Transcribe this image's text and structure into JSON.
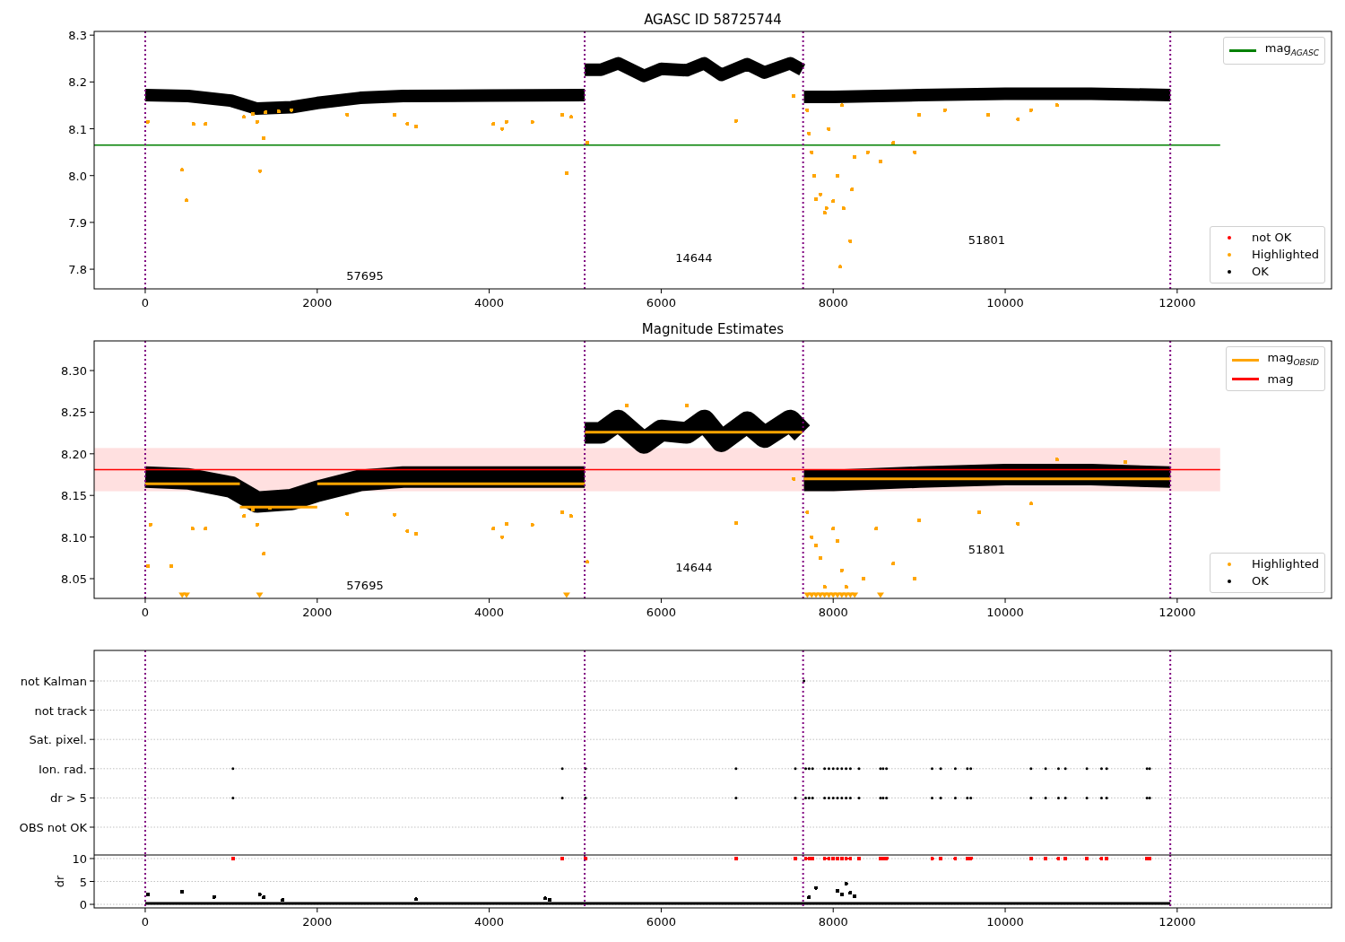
{
  "figure": {
    "panels": [
      {
        "chart_data": {
          "type": "scatter",
          "title": "AGASC ID 58725744",
          "xlim": [
            -594,
            13795
          ],
          "ylim": [
            7.758,
            8.308
          ],
          "xticks": [
            0,
            2000,
            4000,
            6000,
            8000,
            10000,
            12000
          ],
          "yticks": [
            {
              "value": 7.8,
              "label": "7.8"
            },
            {
              "value": 7.9,
              "label": "7.9"
            },
            {
              "value": 8,
              "label": "8.0"
            },
            {
              "value": 8.1,
              "label": "8.1"
            },
            {
              "value": 8.2,
              "label": "8.2"
            },
            {
              "value": 8.3,
              "label": "8.3"
            }
          ],
          "ref_lines": [
            {
              "axis": "y",
              "value": 8.065,
              "color": "#008000"
            },
            {
              "axis": "x",
              "value": 0,
              "color": "#800080"
            },
            {
              "axis": "x",
              "value": 5110,
              "color": "#800080"
            },
            {
              "axis": "x",
              "value": 7650,
              "color": "#800080"
            },
            {
              "axis": "x",
              "value": 11920,
              "color": "#800080"
            }
          ],
          "series": [
            {
              "type": "line",
              "color": "#000000",
              "x": [
                0,
                500,
                1000,
                1300,
                1700,
                2000,
                2500,
                3000,
                4000,
                5110
              ],
              "values": [
                8.172,
                8.17,
                8.16,
                8.143,
                8.146,
                8.155,
                8.166,
                8.17,
                8.171,
                8.172
              ]
            },
            {
              "type": "line",
              "color": "#000000",
              "x": [
                5110,
                5300,
                5500,
                5800,
                6000,
                6300,
                6500,
                6700,
                7000,
                7200,
                7500,
                7640
              ],
              "values": [
                8.226,
                8.226,
                8.24,
                8.213,
                8.228,
                8.225,
                8.24,
                8.215,
                8.238,
                8.22,
                8.24,
                8.226
              ]
            },
            {
              "type": "line",
              "color": "#000000",
              "x": [
                7660,
                8000,
                9000,
                10000,
                11000,
                11920
              ],
              "values": [
                8.168,
                8.168,
                8.172,
                8.175,
                8.175,
                8.172
              ]
            },
            {
              "type": "scatter",
              "color": "#ffa500",
              "x": [
                30,
                280,
                430,
                480,
                560,
                700,
                1150,
                1250,
                1300,
                1330,
                1380,
                1400,
                1550,
                1700,
                2350,
                2900,
                3050,
                3150,
                4050,
                4150,
                4200,
                4500,
                4850,
                4900,
                4950,
                5140,
                6870,
                7540,
                7700,
                7720,
                7750,
                7780,
                7800,
                7850,
                7900,
                7920,
                7950,
                8000,
                8050,
                8080,
                8100,
                8120,
                8200,
                8220,
                8250,
                8400,
                8550,
                8700,
                8950,
                9000,
                9300,
                9800,
                10150,
                10300,
                10600
              ],
              "values": [
                8.115,
                null,
                8.012,
                7.947,
                8.11,
                8.11,
                8.125,
                8.132,
                8.115,
                8.01,
                8.08,
                8.135,
                8.137,
                8.14,
                8.13,
                8.13,
                8.11,
                8.105,
                8.11,
                8.1,
                8.115,
                8.115,
                8.13,
                8.005,
                8.125,
                8.07,
                8.117,
                8.17,
                8.14,
                8.09,
                8.05,
                8.0,
                7.95,
                7.96,
                7.92,
                7.93,
                8.1,
                7.945,
                8.0,
                7.805,
                8.15,
                7.93,
                7.86,
                7.97,
                8.04,
                8.05,
                8.03,
                8.07,
                8.05,
                8.13,
                8.14,
                8.13,
                8.12,
                8.14,
                8.15
              ]
            }
          ],
          "annotations": [
            "57695",
            "14644",
            "51801"
          ]
        },
        "legends": [
          {
            "entries": [
              {
                "label": "mag$_{AGASC}$",
                "kind": "line",
                "color": "#008000"
              }
            ]
          },
          {
            "entries": [
              {
                "label": "not OK",
                "kind": "dot",
                "color": "#ff0000"
              },
              {
                "label": "Highlighted",
                "kind": "dot",
                "color": "#ffa500"
              },
              {
                "label": "OK",
                "kind": "dot",
                "color": "#000000"
              }
            ]
          }
        ]
      },
      {
        "chart_data": {
          "type": "scatter",
          "title": "Magnitude Estimates",
          "xlim": [
            -594,
            13795
          ],
          "ylim": [
            8.0263,
            8.3356
          ],
          "xticks": [
            0,
            2000,
            4000,
            6000,
            8000,
            10000,
            12000
          ],
          "yticks": [
            {
              "value": 8.05,
              "label": "8.05"
            },
            {
              "value": 8.1,
              "label": "8.10"
            },
            {
              "value": 8.15,
              "label": "8.15"
            },
            {
              "value": 8.2,
              "label": "8.20"
            },
            {
              "value": 8.25,
              "label": "8.25"
            },
            {
              "value": 8.3,
              "label": "8.30"
            }
          ],
          "bands": [
            {
              "axis": "y",
              "from": 8.155,
              "to": 8.207,
              "color": "#ff0000"
            }
          ],
          "ref_lines": [
            {
              "axis": "y",
              "value": 8.181,
              "color": "#ff0000"
            },
            {
              "axis": "x",
              "value": 0,
              "color": "#800080"
            },
            {
              "axis": "x",
              "value": 5110,
              "color": "#800080"
            },
            {
              "axis": "x",
              "value": 7650,
              "color": "#800080"
            },
            {
              "axis": "x",
              "value": 11920,
              "color": "#800080"
            }
          ],
          "series": [
            {
              "type": "line",
              "color": "#000000",
              "x": [
                0,
                500,
                1000,
                1300,
                1700,
                2000,
                2500,
                3000,
                4000,
                5110
              ],
              "values": [
                8.172,
                8.17,
                8.16,
                8.142,
                8.145,
                8.155,
                8.168,
                8.172,
                8.172,
                8.172
              ]
            },
            {
              "type": "line",
              "color": "#000000",
              "x": [
                5110,
                5300,
                5500,
                5800,
                6000,
                6300,
                6500,
                6700,
                7000,
                7200,
                7500,
                7640
              ],
              "values": [
                8.225,
                8.225,
                8.24,
                8.213,
                8.228,
                8.225,
                8.24,
                8.215,
                8.238,
                8.22,
                8.24,
                8.225
              ]
            },
            {
              "type": "line",
              "color": "#000000",
              "x": [
                7660,
                8000,
                9000,
                10000,
                11000,
                11920
              ],
              "values": [
                8.168,
                8.168,
                8.172,
                8.175,
                8.175,
                8.172
              ]
            },
            {
              "type": "line",
              "color": "#ffa500",
              "x": [
                0,
                1100
              ],
              "values": [
                8.164,
                8.164
              ]
            },
            {
              "type": "line",
              "color": "#ffa500",
              "x": [
                1100,
                2000
              ],
              "values": [
                8.136,
                8.136
              ]
            },
            {
              "type": "line",
              "color": "#ffa500",
              "x": [
                2000,
                5110
              ],
              "values": [
                8.164,
                8.164
              ]
            },
            {
              "type": "line",
              "color": "#ffa500",
              "x": [
                5110,
                7640
              ],
              "values": [
                8.226,
                8.226
              ]
            },
            {
              "type": "line",
              "color": "#ffa500",
              "x": [
                7660,
                11920
              ],
              "values": [
                8.17,
                8.17
              ]
            },
            {
              "type": "scatter",
              "color": "#ffa500",
              "x": [
                30,
                60,
                300,
                550,
                700,
                1150,
                1250,
                1300,
                1380,
                1450,
                2350,
                2900,
                3050,
                3150,
                4050,
                4150,
                4200,
                4500,
                4850,
                4950,
                5140,
                5600,
                6300,
                6870,
                7540,
                7700,
                7750,
                7800,
                7850,
                7900,
                8000,
                8050,
                8100,
                8150,
                8350,
                8500,
                8700,
                8950,
                9000,
                9700,
                10150,
                10300,
                10600,
                11400
              ],
              "values": [
                8.065,
                8.115,
                8.065,
                8.11,
                8.11,
                8.125,
                8.133,
                8.115,
                8.08,
                8.135,
                8.128,
                8.127,
                8.107,
                8.104,
                8.11,
                8.1,
                8.116,
                8.115,
                8.13,
                8.125,
                8.07,
                8.258,
                8.258,
                8.117,
                8.17,
                8.13,
                8.1,
                8.09,
                8.075,
                8.04,
                8.11,
                8.095,
                8.06,
                8.04,
                8.05,
                8.11,
                8.068,
                8.05,
                8.12,
                8.13,
                8.116,
                8.14,
                8.193,
                8.19
              ]
            },
            {
              "type": "scatter",
              "marker": "v",
              "color": "#ffa500",
              "x": [
                430,
                480,
                1330,
                4900,
                7700,
                7750,
                7800,
                7850,
                7900,
                7950,
                8000,
                8050,
                8100,
                8150,
                8200,
                8250,
                8550
              ],
              "values": [
                8.03,
                8.03,
                8.03,
                8.03,
                8.03,
                8.03,
                8.03,
                8.03,
                8.03,
                8.03,
                8.03,
                8.03,
                8.03,
                8.03,
                8.03,
                8.03,
                8.03
              ]
            }
          ],
          "annotations": [
            "57695",
            "14644",
            "51801"
          ]
        },
        "legends": [
          {
            "entries": [
              {
                "label": "mag$_{OBSID}$",
                "kind": "line",
                "color": "#ffa500"
              },
              {
                "label": "mag",
                "kind": "line",
                "color": "#ff0000"
              }
            ]
          },
          {
            "entries": [
              {
                "label": "Highlighted",
                "kind": "dot",
                "color": "#ffa500"
              },
              {
                "label": "OK",
                "kind": "dot",
                "color": "#000000"
              }
            ]
          }
        ]
      },
      {
        "flag_rows": [
          {
            "label": "not Kalman"
          },
          {
            "label": "not track"
          },
          {
            "label": "Sat. pixel."
          },
          {
            "label": "Ion. rad."
          },
          {
            "label": "dr > 5"
          },
          {
            "label": "OBS not OK"
          }
        ]
      },
      {
        "chart_data": {
          "type": "scatter",
          "ylabel": "dr",
          "xlim": [
            -594,
            13795
          ],
          "ylim": [
            -0.78,
            10.78
          ],
          "xticks": [
            0,
            2000,
            4000,
            6000,
            8000,
            10000,
            12000
          ],
          "yticks": [
            0,
            5,
            10
          ],
          "grid": true,
          "ref_lines": [
            {
              "axis": "x",
              "value": 0,
              "color": "#800080"
            },
            {
              "axis": "x",
              "value": 5110,
              "color": "#800080"
            },
            {
              "axis": "x",
              "value": 7650,
              "color": "#800080"
            },
            {
              "axis": "x",
              "value": 11920,
              "color": "#800080"
            }
          ],
          "series": [
            {
              "type": "line",
              "color": "#000000",
              "x": [
                0,
                2000,
                4000,
                6000,
                8000,
                10000,
                11920
              ],
              "values": [
                0.2,
                0.2,
                0.2,
                0.2,
                0.2,
                0.2,
                0.2
              ]
            },
            {
              "type": "scatter",
              "color": "#000000",
              "x": [
                30,
                430,
                800,
                1330,
                1380,
                1600,
                3150,
                4650,
                4700,
                7720,
                7800,
                8050,
                8100,
                8150,
                8200,
                8250
              ],
              "values": [
                2.2,
                2.7,
                1.6,
                2.1,
                1.5,
                0.9,
                1.1,
                1.3,
                1.0,
                1.5,
                3.6,
                3.0,
                2.2,
                4.5,
                2.5,
                1.8
              ]
            },
            {
              "type": "scatter",
              "color": "#ff0000",
              "x": [
                1020,
                4850,
                5120,
                6870,
                7560,
                7680,
                7720,
                7760,
                7900,
                7950,
                8000,
                8050,
                8100,
                8150,
                8200,
                8300,
                8550,
                8580,
                8620,
                9150,
                9250,
                9420,
                9560,
                9600,
                10300,
                10470,
                10620,
                10700,
                10950,
                11120,
                11180,
                11650,
                11680
              ],
              "values": [
                10,
                10,
                10,
                10,
                10,
                10,
                10,
                10,
                10,
                10,
                10,
                10,
                10,
                10,
                10,
                10,
                10,
                10,
                10,
                10,
                10,
                10,
                10,
                10,
                10,
                10,
                10,
                10,
                10,
                10,
                10,
                10,
                10
              ]
            }
          ]
        }
      }
    ]
  }
}
